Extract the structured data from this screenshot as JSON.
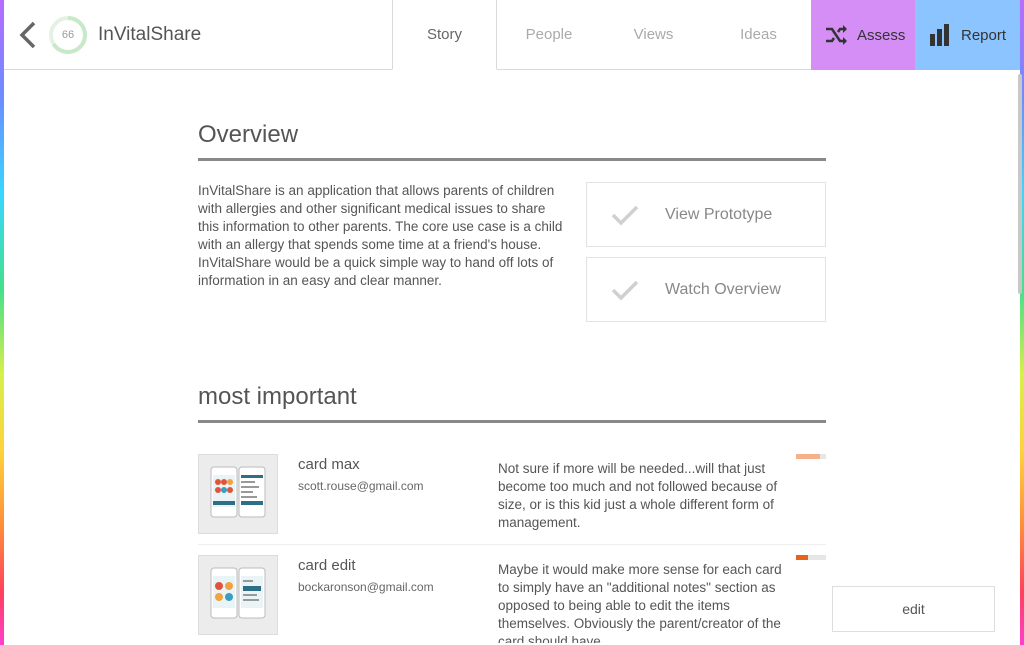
{
  "header": {
    "app_title": "InVitalShare",
    "score": "66",
    "score_fraction": 0.66,
    "tabs": [
      {
        "label": "Story"
      },
      {
        "label": "People"
      },
      {
        "label": "Views"
      },
      {
        "label": "Ideas"
      }
    ],
    "assess_label": "Assess",
    "report_label": "Report",
    "assess_color": "#d48ef5",
    "report_color": "#8cc4ff"
  },
  "overview": {
    "title": "Overview",
    "description": "InVitalShare is an application that allows parents of children with allergies and other significant medical issues to share this information to other parents. The core use case is a child with an allergy that spends some time at a friend's house. InVitalShare would be a quick simple way to hand off lots of information in an easy and clear manner.",
    "prototype_label": "View Prototype",
    "watch_label": "Watch Overview"
  },
  "important": {
    "title": "most important",
    "items": [
      {
        "title": "card max",
        "email": "scott.rouse@gmail.com",
        "comment": "Not sure if more will be needed...will that just become too much and not followed because of size, or is this kid just a whole different form of management.",
        "bar_fraction": 0.8,
        "bar_color": "#f6b08a"
      },
      {
        "title": "card edit",
        "email": "bockaronson@gmail.com",
        "comment": "Maybe it would make more sense for each card to simply have an \"additional notes\" section as opposed to being able to edit the items themselves. Obviously the parent/creator of the card should have",
        "bar_fraction": 0.4,
        "bar_color": "#e8621c"
      }
    ]
  },
  "edit_label": "edit"
}
